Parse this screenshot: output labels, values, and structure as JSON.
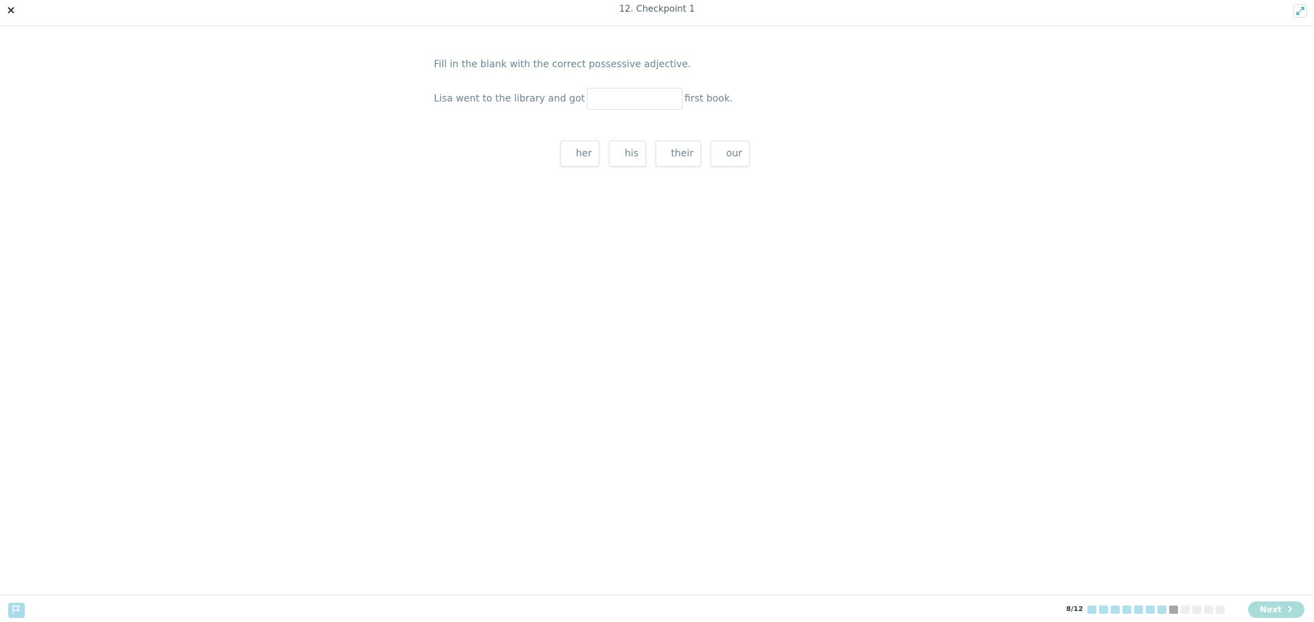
{
  "header": {
    "close_label": "×",
    "title": "12. Checkpoint 1"
  },
  "question": {
    "instruction": "Fill in the blank with the correct possessive adjective.",
    "sentence_before": "Lisa went to the library and got",
    "sentence_after": "first book.",
    "blank_value": ""
  },
  "options": [
    "her",
    "his",
    "their",
    "our"
  ],
  "footer": {
    "progress_text": "8/12",
    "total_steps": 12,
    "completed_steps": 7,
    "current_step": 8,
    "next_label": "Next",
    "accent_color": "#a8dcd8",
    "done_color": "#aee0ee"
  }
}
